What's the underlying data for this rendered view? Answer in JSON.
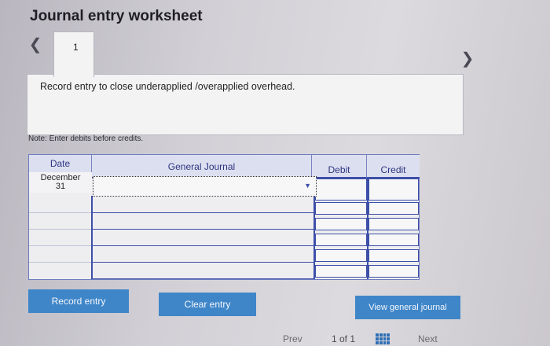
{
  "header": {
    "title": "Journal entry worksheet"
  },
  "tabs": [
    {
      "label": "1"
    }
  ],
  "instruction": "Record entry to close underapplied /overapplied overhead.",
  "note": "Note: Enter debits before credits.",
  "table": {
    "columns": [
      "Date",
      "General Journal",
      "Debit",
      "Credit"
    ],
    "first_row": {
      "date_line1": "December",
      "date_line2": "31",
      "account": "",
      "debit": "",
      "credit": ""
    }
  },
  "buttons": {
    "record": "Record entry",
    "clear": "Clear entry",
    "view": "View general journal"
  },
  "pagination": {
    "prev": "Prev",
    "page": "1 of 1",
    "next": "Next"
  },
  "icons": {
    "prev": "chevron-left-icon",
    "next": "chevron-right-icon",
    "grid": "grid-icon"
  },
  "colors": {
    "accent": "#3f86c9",
    "table_border": "#3d4fa8"
  }
}
